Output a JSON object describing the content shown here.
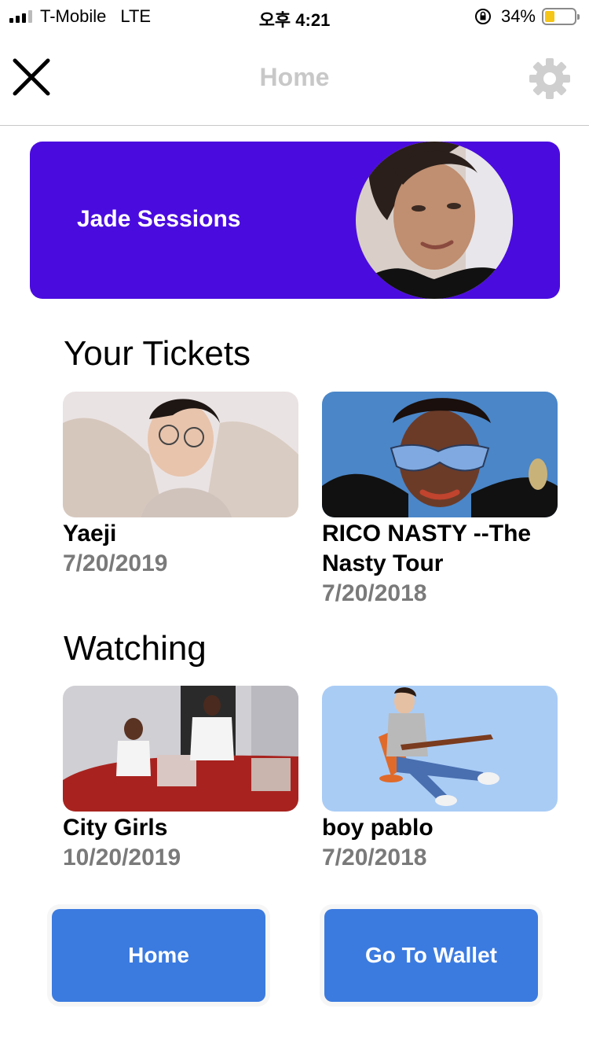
{
  "status_bar": {
    "carrier": "T-Mobile",
    "network": "LTE",
    "time": "오후 4:21",
    "battery_percent_text": "34%",
    "battery_level": 0.34,
    "battery_color": "#f5c518"
  },
  "nav": {
    "title": "Home",
    "close_icon": "close-icon",
    "settings_icon": "gear-icon"
  },
  "profile": {
    "name": "Jade Sessions",
    "card_color": "#4a0bdf"
  },
  "tickets": {
    "heading": "Your Tickets",
    "items": [
      {
        "title": "Yaeji",
        "date": "7/20/2019"
      },
      {
        "title": "RICO NASTY --The Nasty Tour",
        "date": "7/20/2018"
      }
    ]
  },
  "watching": {
    "heading": "Watching",
    "items": [
      {
        "title": "City Girls",
        "date": "10/20/2019"
      },
      {
        "title": "boy pablo",
        "date": "7/20/2018"
      }
    ]
  },
  "buttons": {
    "home_label": "Home",
    "wallet_label": "Go To Wallet",
    "color": "#3b7be0"
  }
}
